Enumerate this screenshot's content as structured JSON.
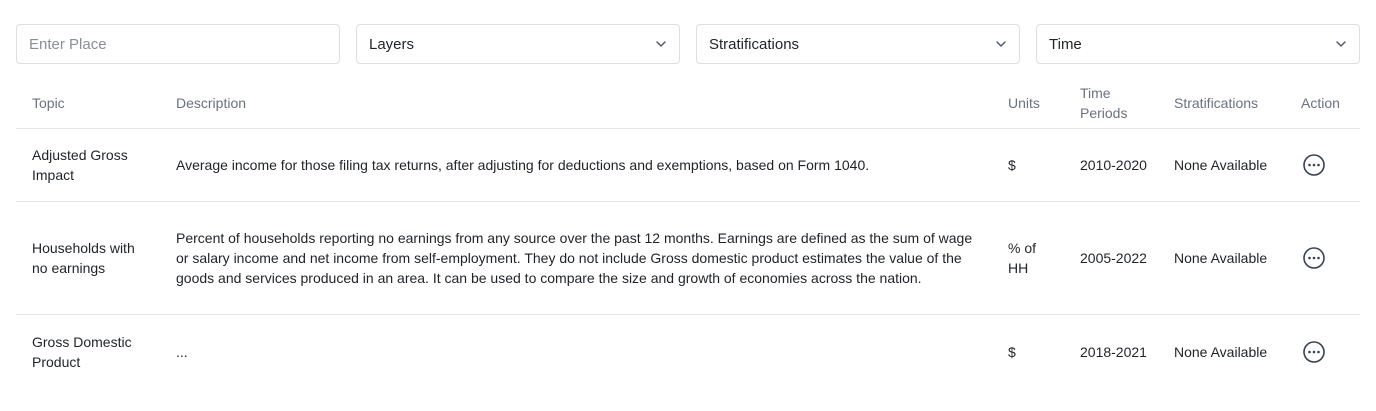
{
  "filters": {
    "place_placeholder": "Enter Place",
    "layers_label": "Layers",
    "stratifications_label": "Stratifications",
    "time_label": "Time"
  },
  "table": {
    "headers": {
      "topic": "Topic",
      "description": "Description",
      "units": "Units",
      "time_periods": "Time Periods",
      "stratifications": "Stratifications",
      "action": "Action"
    },
    "rows": [
      {
        "topic": "Adjusted Gross Impact",
        "description": "Average income for those filing tax returns, after adjusting for deductions and exemptions, based on Form 1040.",
        "units": "$",
        "time_periods": "2010-2020",
        "stratifications": "None Available"
      },
      {
        "topic": "Households with no earnings",
        "description": "Percent of households reporting no earnings from any source over the past 12 months. Earnings are defined as the sum of wage or salary income and net income from self-employment. They do not include Gross domestic product estimates the value of the goods and services produced in an area. It can be used to compare the size and growth of economies across the nation.",
        "units": "% of HH",
        "time_periods": "2005-2022",
        "stratifications": "None Available"
      },
      {
        "topic": "Gross Domestic Product",
        "description": "...",
        "units": "$",
        "time_periods": "2018-2021",
        "stratifications": "None Available"
      }
    ]
  },
  "icons": {
    "chevron": "chevron-down-icon",
    "action": "more-horizontal-circle-icon"
  }
}
